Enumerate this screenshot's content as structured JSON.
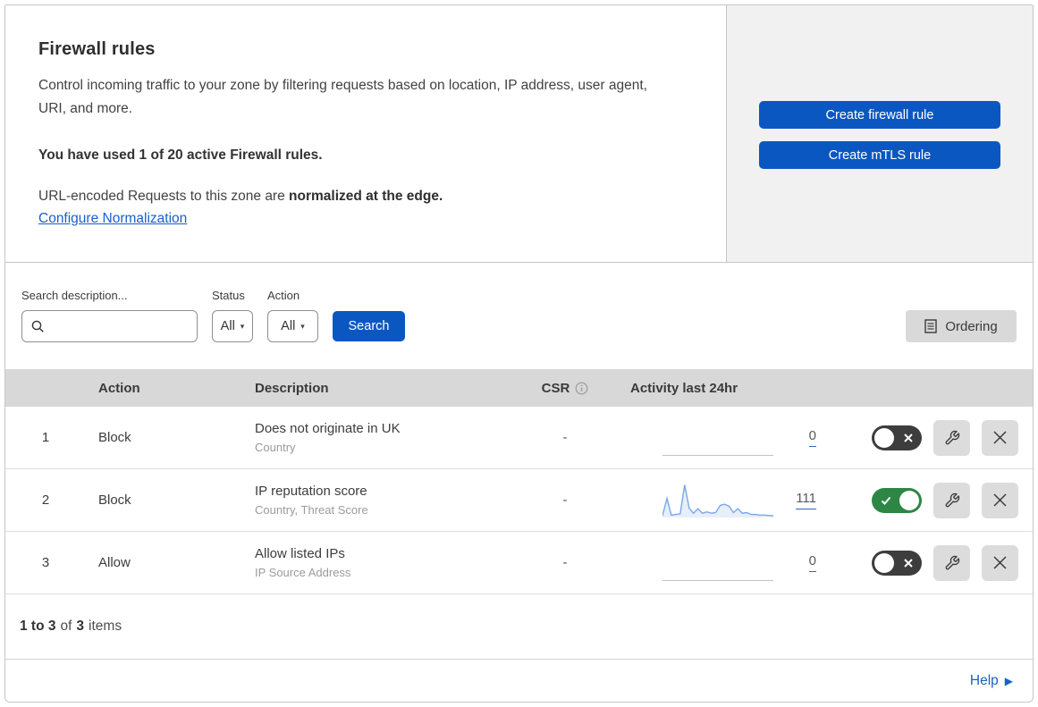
{
  "header": {
    "title": "Firewall rules",
    "description": "Control incoming traffic to your zone by filtering requests based on location, IP address, user agent, URI, and more.",
    "usage": "You have used 1 of 20 active Firewall rules.",
    "normalization_prefix": "URL-encoded Requests to this zone are ",
    "normalization_bold": "normalized at the edge.",
    "normalization_link": "Configure Normalization",
    "create_firewall_button": "Create firewall rule",
    "create_mtls_button": "Create mTLS rule"
  },
  "filters": {
    "search_label": "Search description...",
    "status_label": "Status",
    "status_value": "All",
    "action_label": "Action",
    "action_value": "All",
    "search_button": "Search",
    "ordering_button": "Ordering"
  },
  "table": {
    "columns": {
      "action": "Action",
      "description": "Description",
      "csr": "CSR",
      "activity": "Activity last 24hr"
    }
  },
  "rows": [
    {
      "priority": "1",
      "action": "Block",
      "description": "Does not originate in UK",
      "filter_fields": "Country",
      "csr": "-",
      "activity_count": "0",
      "enabled": false,
      "sparkline": []
    },
    {
      "priority": "2",
      "action": "Block",
      "description": "IP reputation score",
      "filter_fields": "Country, Threat Score",
      "csr": "-",
      "activity_count": "111",
      "enabled": true,
      "sparkline": [
        4,
        58,
        6,
        8,
        10,
        100,
        28,
        12,
        26,
        12,
        16,
        12,
        14,
        36,
        40,
        34,
        14,
        26,
        12,
        14,
        8,
        8,
        6,
        6,
        5,
        4
      ]
    },
    {
      "priority": "3",
      "action": "Allow",
      "description": "Allow listed IPs",
      "filter_fields": "IP Source Address",
      "csr": "-",
      "activity_count": "0",
      "enabled": false,
      "sparkline": []
    }
  ],
  "footer": {
    "range": "1 to 3",
    "of": "of",
    "total": "3",
    "items": "items"
  },
  "help": {
    "label": "Help"
  },
  "colors": {
    "primary_blue": "#0b57c2",
    "link_blue": "#1a5fc8",
    "toggle_on_green": "#2e8644",
    "toggle_off_gray": "#3d3d3d",
    "table_header_gray": "#d8d8d8",
    "side_panel_gray": "#f1f1f1",
    "sparkline_blue": "#7aa7e8"
  }
}
